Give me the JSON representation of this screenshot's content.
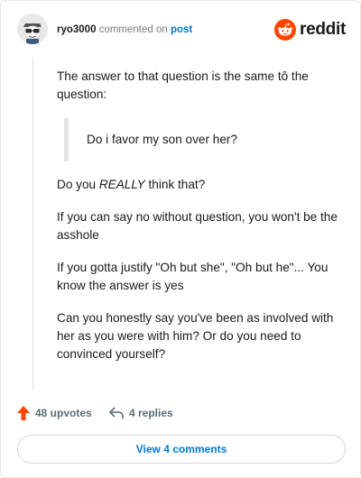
{
  "header": {
    "username": "ryo3000",
    "commented_text": "commented on",
    "post_link": "post",
    "logo_text": "reddit",
    "brand_color": "#ff4500"
  },
  "comment": {
    "paragraph_1": "The answer to that question is the same tô the question:",
    "quote": "Do i favor my son over her?",
    "paragraph_2_before": "Do you ",
    "paragraph_2_emph": "REALLY",
    "paragraph_2_after": " think that?",
    "paragraph_3": "If you can say no without question, you won't be the asshole",
    "paragraph_4": "If you gotta justify \"Oh but she\", \"Oh but he\"... You know the answer is yes",
    "paragraph_5": "Can you honestly say you've been as involved with her as you were with him? Or do you need to convinced yourself?"
  },
  "actions": {
    "upvotes": "48 upvotes",
    "upvote_icon": "upvote-arrow-icon",
    "replies": "4 replies",
    "reply_icon": "reply-arrow-icon"
  },
  "footer": {
    "view_comments": "View 4 comments"
  }
}
